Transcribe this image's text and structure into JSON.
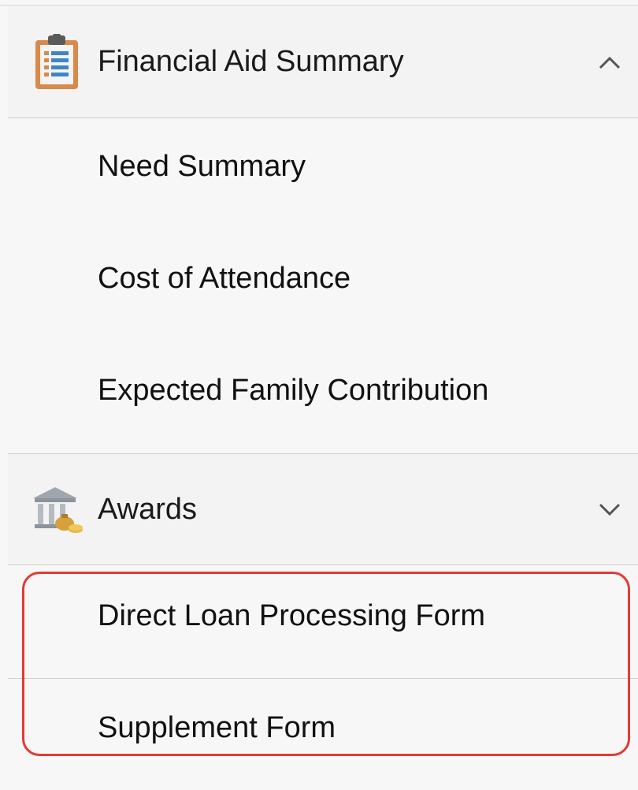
{
  "menu": {
    "sections": [
      {
        "title": "Financial Aid Summary",
        "icon": "clipboard-list-icon",
        "expanded": true,
        "chevron": "chevron-up-icon",
        "items": [
          "Need Summary",
          "Cost of Attendance",
          "Expected Family Contribution"
        ]
      },
      {
        "title": "Awards",
        "icon": "bank-money-icon",
        "expanded": false,
        "chevron": "chevron-down-icon",
        "items": [
          "Direct Loan Processing Form",
          "Supplement Form"
        ]
      }
    ]
  },
  "colors": {
    "background": "#f7f7f7",
    "highlight": "#e53935",
    "divider": "#cfcfcf",
    "icon_orange": "#d9894a",
    "icon_blue": "#3d86c6"
  }
}
